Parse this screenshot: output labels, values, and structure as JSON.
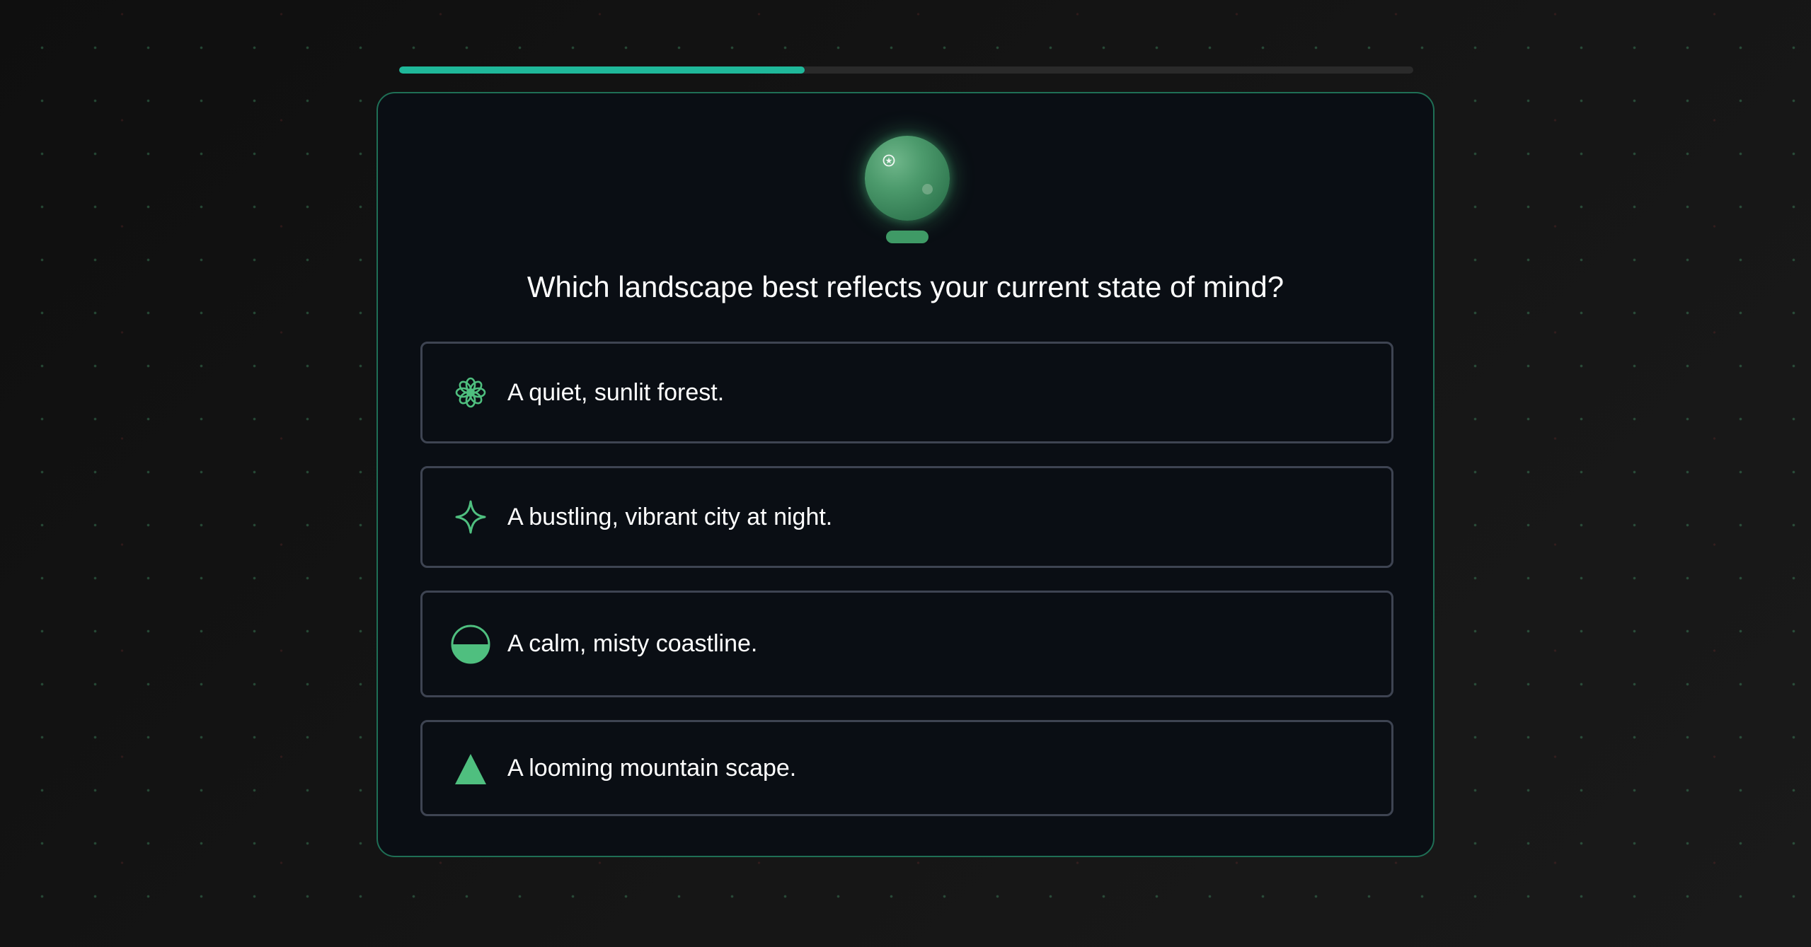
{
  "quiz": {
    "progress": 0.4,
    "question": "Which landscape best reflects your current state of mind?",
    "orb_icon": "crystal-ball-icon",
    "accent_color": "#1fb89a",
    "icon_color": "#4fbf7f",
    "options": [
      {
        "icon": "flower-icon",
        "label": "A quiet, sunlit forest."
      },
      {
        "icon": "sparkle-icon",
        "label": "A bustling, vibrant city at night."
      },
      {
        "icon": "half-circle-icon",
        "label": "A calm, misty coastline."
      },
      {
        "icon": "triangle-icon",
        "label": "A looming mountain scape."
      }
    ]
  }
}
